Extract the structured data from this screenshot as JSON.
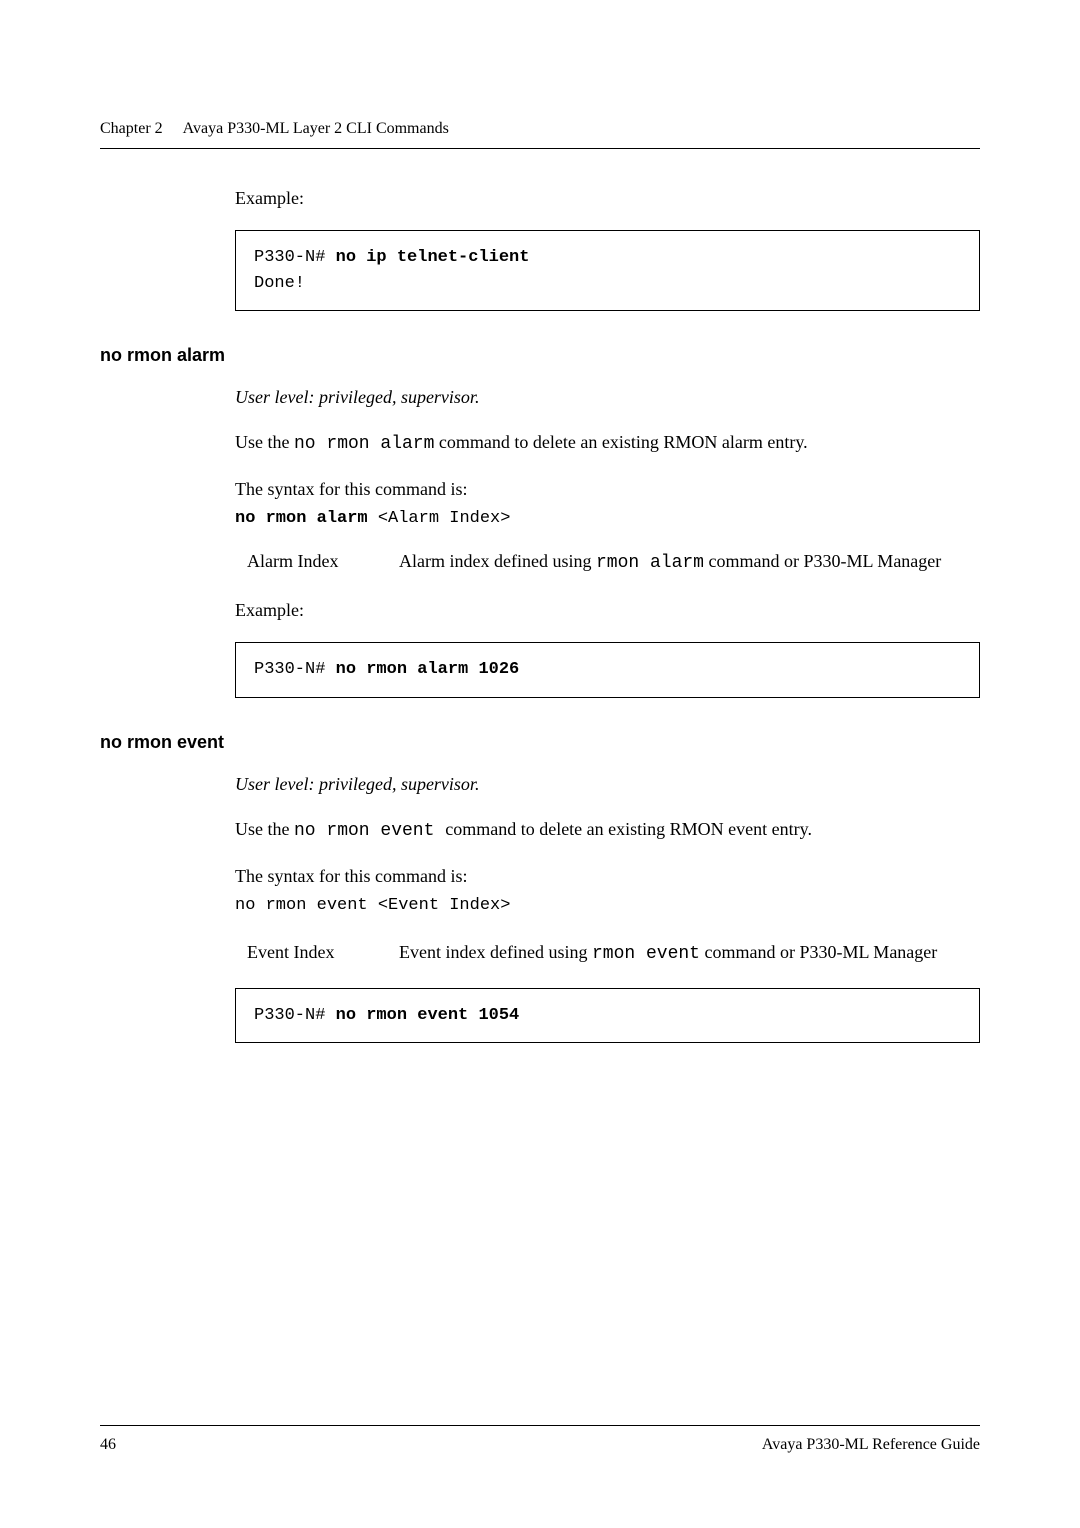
{
  "header": {
    "chapter_label": "Chapter 2",
    "chapter_title": "Avaya P330-ML Layer 2 CLI Commands"
  },
  "top_example": {
    "label": "Example:",
    "prompt": "P330-N#",
    "cmd": "no ip telnet-client",
    "output": "Done!"
  },
  "section_alarm": {
    "heading": "no rmon alarm",
    "user_level": "User level: privileged, supervisor.",
    "desc_pre": "Use the ",
    "desc_cmd": "no rmon alarm",
    "desc_post": " command to delete an existing RMON alarm entry.",
    "syntax_label": "The syntax for this command is:",
    "syntax_cmd": "no rmon alarm",
    "syntax_arg": " <Alarm Index>",
    "param_name": "Alarm Index",
    "param_desc_pre": "Alarm index defined using ",
    "param_desc_cmd": "rmon alarm",
    "param_desc_post": " command or P330-ML Manager",
    "example_label": "Example:",
    "example_prompt": "P330-N#",
    "example_cmd": "no rmon alarm 1026"
  },
  "section_event": {
    "heading": "no rmon event",
    "user_level": "User level: privileged, supervisor.",
    "desc_pre": "Use the ",
    "desc_cmd": " no rmon event ",
    "desc_post": " command to delete an existing RMON event entry.",
    "syntax_label": "The syntax for this command is:",
    "syntax_line": "no rmon event <Event Index>",
    "param_name": "Event Index",
    "param_desc_pre": "Event index defined using ",
    "param_desc_cmd": "rmon event",
    "param_desc_post": " command or P330-ML Manager",
    "example_prompt": "P330-N#",
    "example_cmd": "no rmon event 1054"
  },
  "footer": {
    "page_number": "46",
    "doc_title": "Avaya P330-ML Reference Guide"
  }
}
